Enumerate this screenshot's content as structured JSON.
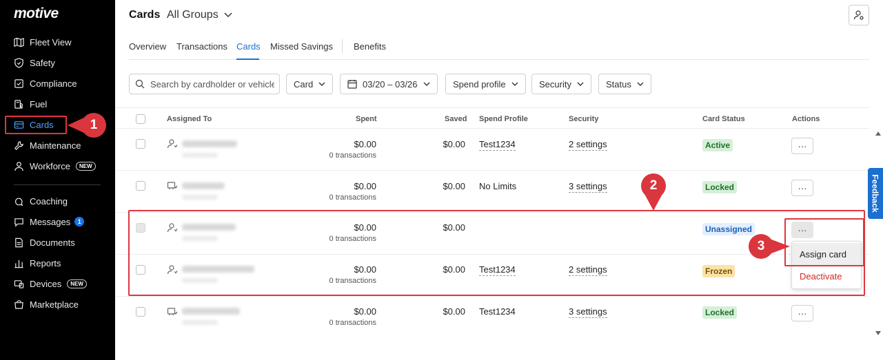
{
  "brand": {
    "logo": "motive"
  },
  "sidebar": {
    "items": [
      {
        "label": "Fleet View",
        "icon": "map-icon"
      },
      {
        "label": "Safety",
        "icon": "shield-icon"
      },
      {
        "label": "Compliance",
        "icon": "clipboard-icon"
      },
      {
        "label": "Fuel",
        "icon": "fuel-icon"
      },
      {
        "label": "Cards",
        "icon": "card-icon",
        "active": true
      },
      {
        "label": "Maintenance",
        "icon": "wrench-icon"
      },
      {
        "label": "Workforce",
        "icon": "person-icon",
        "badge": "NEW"
      },
      {
        "label": "Coaching",
        "icon": "coaching-icon"
      },
      {
        "label": "Messages",
        "icon": "message-icon",
        "count": "1"
      },
      {
        "label": "Documents",
        "icon": "document-icon"
      },
      {
        "label": "Reports",
        "icon": "reports-icon"
      },
      {
        "label": "Devices",
        "icon": "devices-icon",
        "badge": "NEW"
      },
      {
        "label": "Marketplace",
        "icon": "marketplace-icon"
      }
    ]
  },
  "header": {
    "title": "Cards",
    "group": "All Groups"
  },
  "tabs": [
    "Overview",
    "Transactions",
    "Cards",
    "Missed Savings",
    "Benefits"
  ],
  "filters": {
    "search_placeholder": "Search by cardholder or vehicle",
    "card": "Card",
    "date_range": "03/20 – 03/26",
    "spend_profile": "Spend profile",
    "security": "Security",
    "status": "Status"
  },
  "table": {
    "headers": {
      "assigned_to": "Assigned To",
      "spent": "Spent",
      "saved": "Saved",
      "spend_profile": "Spend Profile",
      "security": "Security",
      "card_status": "Card Status",
      "actions": "Actions"
    },
    "rows": [
      {
        "spent": "$0.00",
        "transactions": "0 transactions",
        "saved": "$0.00",
        "spend_profile": "Test1234",
        "security": "2 settings",
        "status": "Active"
      },
      {
        "spent": "$0.00",
        "transactions": "0 transactions",
        "saved": "$0.00",
        "spend_profile": "No Limits",
        "security": "3 settings",
        "status": "Locked"
      },
      {
        "spent": "$0.00",
        "transactions": "0 transactions",
        "saved": "$0.00",
        "spend_profile": "",
        "security": "",
        "status": "Unassigned"
      },
      {
        "spent": "$0.00",
        "transactions": "0 transactions",
        "saved": "$0.00",
        "spend_profile": "Test1234",
        "security": "2 settings",
        "status": "Frozen"
      },
      {
        "spent": "$0.00",
        "transactions": "0 transactions",
        "saved": "$0.00",
        "spend_profile": "Test1234",
        "security": "3 settings",
        "status": "Locked"
      }
    ],
    "actions_label": "···"
  },
  "action_menu": {
    "assign": "Assign card",
    "deactivate": "Deactivate"
  },
  "annotations": {
    "m1": "1",
    "m2": "2",
    "m3": "3"
  },
  "feedback": "Feedback",
  "colors": {
    "accent": "#1a6fd1",
    "annotation": "#d9363e",
    "sidebar_bg": "#000000"
  }
}
